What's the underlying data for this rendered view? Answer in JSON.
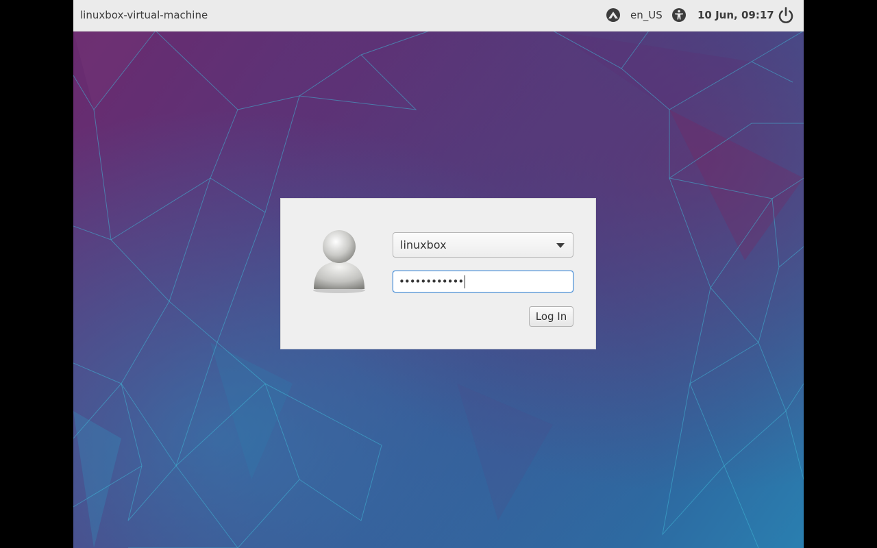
{
  "panel": {
    "hostname": "linuxbox-virtual-machine",
    "network_icon": "network-wired-icon",
    "language": "en_US",
    "accessibility_icon": "accessibility-icon",
    "datetime": "10 Jun, 09:17",
    "power_icon": "power-icon"
  },
  "login": {
    "avatar_icon": "user-avatar-icon",
    "user_select": {
      "selected": "linuxbox",
      "arrow_icon": "chevron-down-icon"
    },
    "password": {
      "value": "••••••••••••"
    },
    "login_button_label": "Log In"
  },
  "colors": {
    "panel_bg": "#ebebeb",
    "dialog_bg": "#efefef",
    "focus_border": "#4a90d9",
    "wallpaper_top": "#6b2a6e",
    "wallpaper_bottom": "#2a7fb0"
  }
}
